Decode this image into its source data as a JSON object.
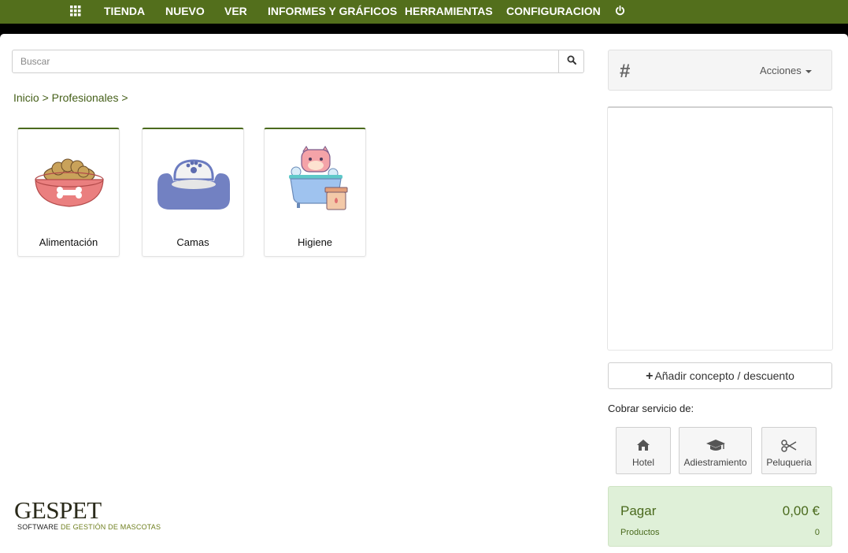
{
  "nav": {
    "items": [
      "TIENDA",
      "NUEVO",
      "VER",
      "INFORMES Y GRÁFICOS",
      "HERRAMIENTAS",
      "CONFIGURACION"
    ],
    "icons": [
      "grid-icon",
      "power-icon"
    ]
  },
  "search": {
    "placeholder": "Buscar",
    "value": ""
  },
  "breadcrumb": "Inicio > Profesionales >",
  "categories": [
    {
      "label": "Alimentación",
      "icon": "food-bowl-icon"
    },
    {
      "label": "Camas",
      "icon": "pet-bed-icon"
    },
    {
      "label": "Higiene",
      "icon": "dog-bath-icon"
    }
  ],
  "logo": {
    "main_a": "GES",
    "main_b": "PET",
    "sub_a": "SOFTWARE",
    "sub_b": "DE GESTIÓN DE MASCOTAS"
  },
  "panel": {
    "hash": "#",
    "actions": "Acciones",
    "add_concept": "Añadir concepto / descuento",
    "service_title": "Cobrar servicio de:",
    "services": [
      {
        "label": "Hotel",
        "icon": "home-icon"
      },
      {
        "label": "Adiestramiento",
        "icon": "graduation-cap-icon"
      },
      {
        "label": "Peluqueria",
        "icon": "scissors-icon"
      }
    ],
    "pay": {
      "label": "Pagar",
      "amount": "0,00 €",
      "products_label": "Productos",
      "products_count": "0"
    }
  },
  "colors": {
    "nav_bg": "#536f1c",
    "accent_green": "#4a6a1d",
    "pay_bg": "#dff0d8"
  }
}
